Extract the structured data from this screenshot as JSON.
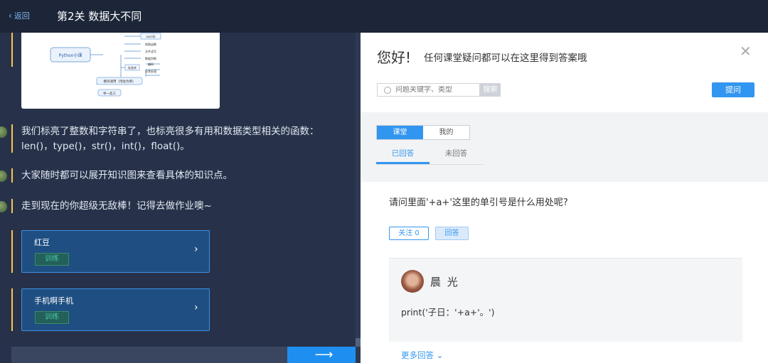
{
  "topbar": {
    "back_label": "返回",
    "title": "第2关 数据大不同"
  },
  "left": {
    "mindmap": {
      "root": "Python小课",
      "nodes": [
        "ascii码",
        "转换函数",
        "文件读写",
        "数据判断",
        "编码",
        "异常处理",
        "模块调用（甩住为例）",
        "举一反三",
        "标准库"
      ]
    },
    "messages": [
      {
        "lines": [
          "我们标亮了整数和字符串了，也标亮很多有用和数据类型相关的函数：",
          "len()，type()，str()，int()，float()。"
        ]
      },
      {
        "lines": [
          "大家随时都可以展开知识图来查看具体的知识点。"
        ]
      },
      {
        "lines": [
          "走到现在的你超级无敌棒！记得去做作业噢~"
        ]
      }
    ],
    "cards": [
      {
        "title": "红豆",
        "tag": "训练"
      },
      {
        "title": "手机啊手机",
        "tag": "训练"
      }
    ],
    "next_arrow": "⟶"
  },
  "right": {
    "greeting": "您好!",
    "subtitle": "任何课堂疑问都可以在这里得到答案哦",
    "search": {
      "placeholder": "问题关键字、类型",
      "button": "搜索"
    },
    "ask_button": "提问",
    "segments": {
      "class": "课堂",
      "mine": "我的"
    },
    "subtabs": {
      "answered": "已回答",
      "unanswered": "未回答"
    },
    "question": {
      "text": "请问里面'+a+'这里的单引号是什么用处呢?",
      "follow": "关注 0",
      "answer": "回答"
    },
    "answer": {
      "name": "晨 光",
      "text": "print('子日：'+a+'。')"
    },
    "more": "更多回答"
  }
}
